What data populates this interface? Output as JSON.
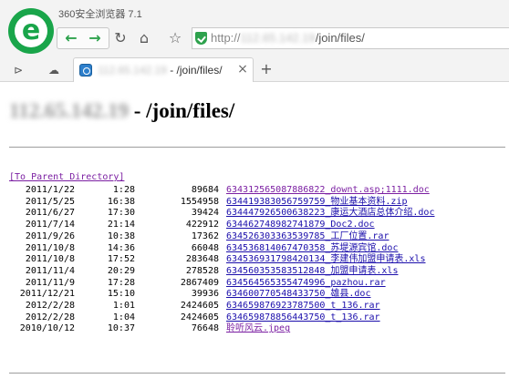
{
  "browser": {
    "app_title": "360安全浏览器 7.1",
    "url_scheme": "http://",
    "url_host": "112.65.142.19",
    "url_path": "/join/files/",
    "tab": {
      "host": "112.65.142.19",
      "title_suffix": " - /join/files/",
      "close": "×"
    },
    "new_tab": "+",
    "icons": {
      "back": "←",
      "forward": "→",
      "reload": "↻",
      "home": "⌂",
      "favorite": "☆",
      "sidebar": "⊳",
      "cloud": "☁"
    }
  },
  "page": {
    "heading_host": "112.65.142.19",
    "heading_path": " - /join/files/",
    "parent_link": "[To Parent Directory]",
    "files": [
      {
        "date": "2011/1/22",
        "time": "1:28",
        "size": "89684",
        "name": "634312565087886822_downt.asp;1111.doc",
        "visited": true
      },
      {
        "date": "2011/5/25",
        "time": "16:38",
        "size": "1554958",
        "name": "634419383056759759_物业基本资料.zip",
        "visited": false
      },
      {
        "date": "2011/6/27",
        "time": "17:30",
        "size": "39424",
        "name": "634447926500638223_康运大酒店总体介绍.doc",
        "visited": false
      },
      {
        "date": "2011/7/14",
        "time": "21:14",
        "size": "422912",
        "name": "634462748982741879_Doc2.doc",
        "visited": false
      },
      {
        "date": "2011/9/26",
        "time": "10:38",
        "size": "17362",
        "name": "634526303363539785_工厂位置.rar",
        "visited": false
      },
      {
        "date": "2011/10/8",
        "time": "14:36",
        "size": "66048",
        "name": "634536814067470358_苏堤源宾馆.doc",
        "visited": false
      },
      {
        "date": "2011/10/8",
        "time": "17:52",
        "size": "283648",
        "name": "634536931798420134_李建伟加盟申请表.xls",
        "visited": false
      },
      {
        "date": "2011/11/4",
        "time": "20:29",
        "size": "278528",
        "name": "634560353583512848_加盟申请表.xls",
        "visited": false
      },
      {
        "date": "2011/11/9",
        "time": "17:28",
        "size": "2867409",
        "name": "634564565355474996_pazhou.rar",
        "visited": false
      },
      {
        "date": "2011/12/21",
        "time": "15:10",
        "size": "39936",
        "name": "634600770548433750_雄县.doc",
        "visited": false
      },
      {
        "date": "2012/2/28",
        "time": "1:01",
        "size": "2424605",
        "name": "634659876923787500_t_136.rar",
        "visited": false
      },
      {
        "date": "2012/2/28",
        "time": "1:04",
        "size": "2424605",
        "name": "634659878856443750_t_136.rar",
        "visited": false
      },
      {
        "date": "2010/10/12",
        "time": "10:37",
        "size": "76648",
        "name": "聆听风云.jpeg",
        "visited": true
      }
    ]
  },
  "colors": {
    "brand_green": "#19a54a",
    "link": "#1a0dab",
    "visited_link": "#7b1fa2"
  }
}
